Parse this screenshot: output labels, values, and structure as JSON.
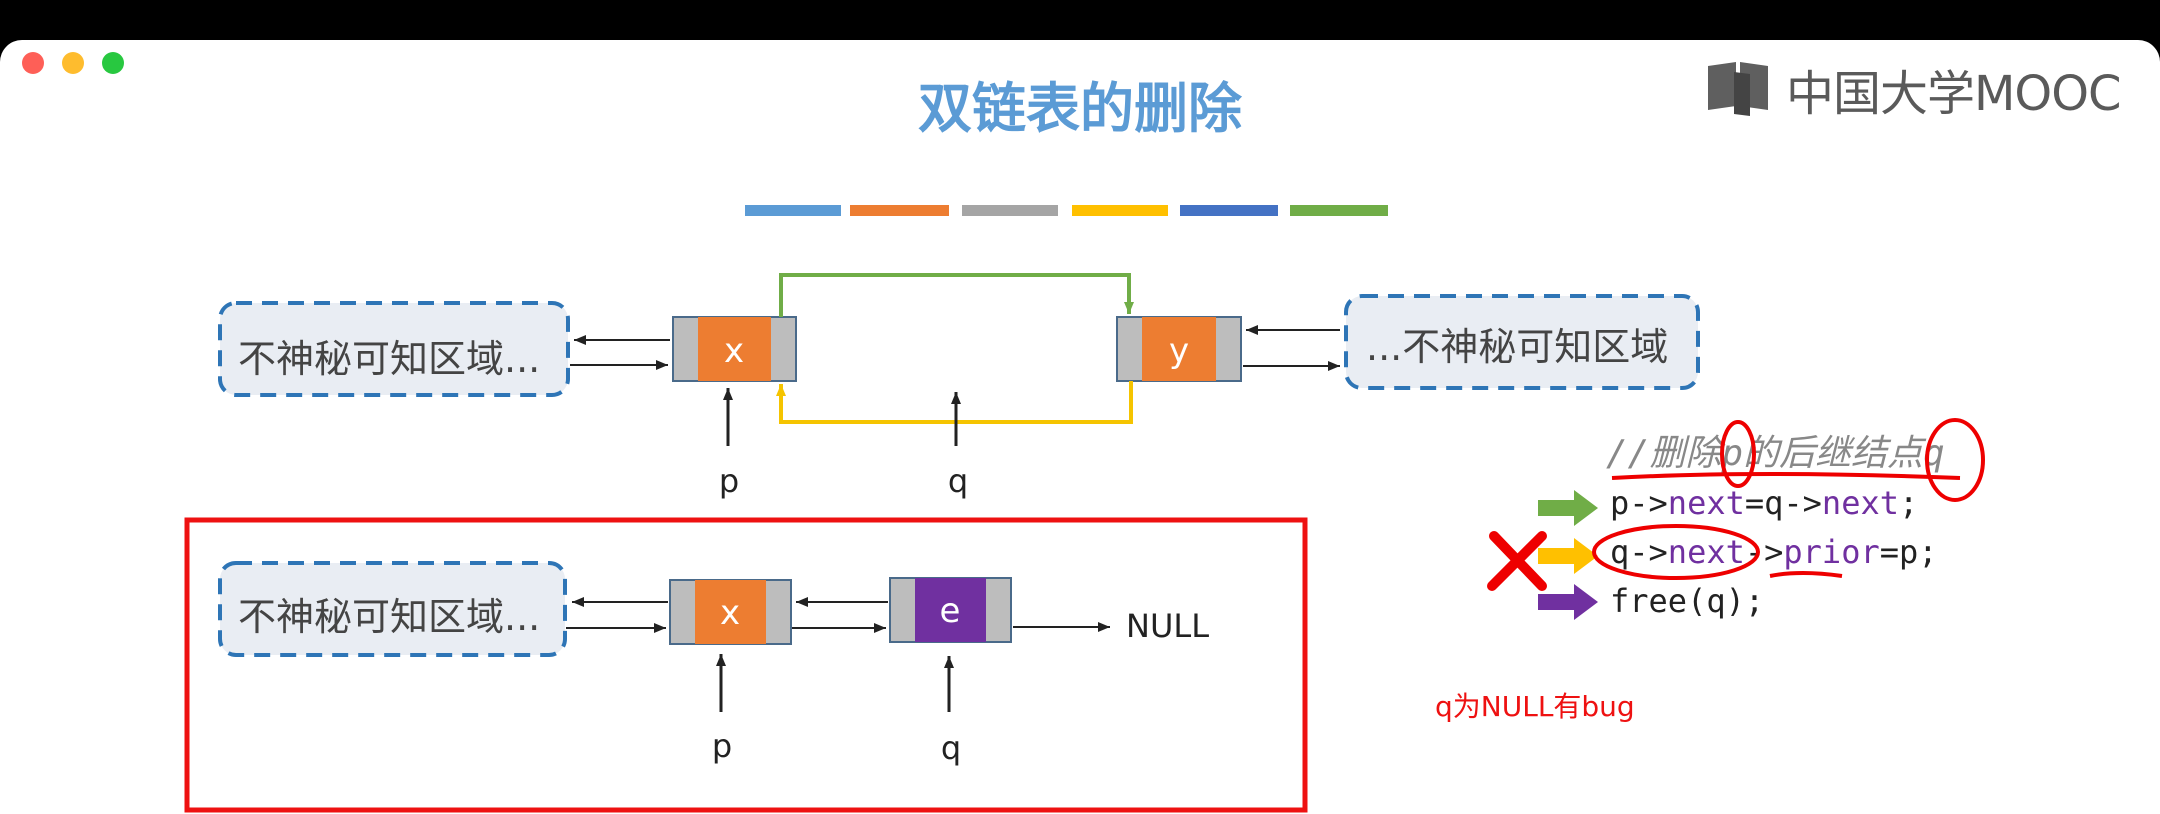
{
  "window": {
    "controls": [
      "close",
      "minimize",
      "maximize"
    ]
  },
  "logo": {
    "text": "中国大学MOOC",
    "icon": "mooc-book-icon"
  },
  "slide": {
    "title": "双链表的删除",
    "title_color": "#5b9bd5",
    "title_underline_colors": [
      "#5b9bd5",
      "#ed7d31",
      "#a5a5a5",
      "#ffc000",
      "#4472c4",
      "#70ad47"
    ]
  },
  "top_diagram": {
    "left_region": "不神秘可知区域...",
    "right_region": "...不神秘可知区域",
    "node_x": "x",
    "node_y": "y",
    "pointer_p": "p",
    "pointer_q": "q"
  },
  "code": {
    "comment": "//删除p的后继结点q",
    "line1": {
      "a": "p->",
      "b": "next",
      "c": "=q->",
      "d": "next",
      "e": ";"
    },
    "line2": {
      "a": "q->",
      "b": "next",
      "c": "->",
      "d": "prior",
      "e": "=p;"
    },
    "line3": "free(q);",
    "keyword_color": "#7030a0",
    "arrow_colors": [
      "#70ad47",
      "#ffc000",
      "#7030a0"
    ]
  },
  "bottom_diagram": {
    "left_region": "不神秘可知区域...",
    "node_x": "x",
    "node_e": "e",
    "null_label": "NULL",
    "pointer_p": "p",
    "pointer_q": "q"
  },
  "annotation": {
    "note": "q为NULL有bug",
    "color": "#ee1111"
  }
}
